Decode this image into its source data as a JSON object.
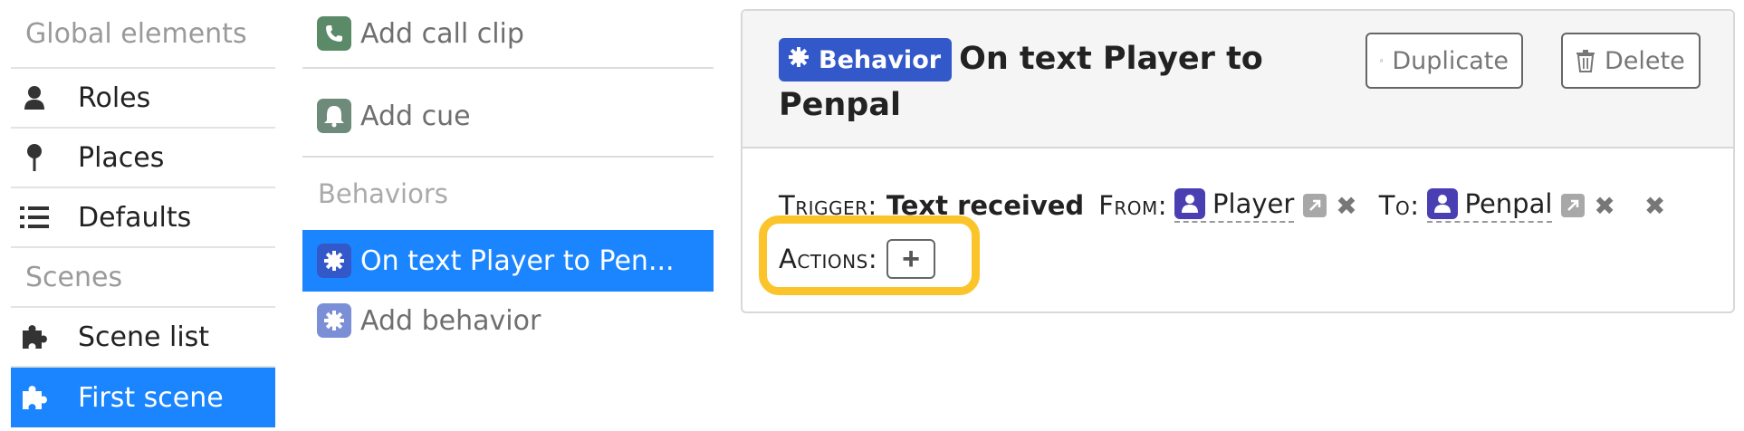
{
  "sidebar": {
    "global_heading": "Global elements",
    "items": [
      {
        "label": "Roles",
        "icon": "person-icon"
      },
      {
        "label": "Places",
        "icon": "map-pin-icon"
      },
      {
        "label": "Defaults",
        "icon": "list-icon"
      }
    ],
    "scenes_heading": "Scenes",
    "scene_items": [
      {
        "label": "Scene list",
        "icon": "puzzle-icon",
        "active": false
      },
      {
        "label": "First scene",
        "icon": "puzzle-icon",
        "active": true
      }
    ]
  },
  "middle": {
    "add_call_clip": "Add call clip",
    "add_cue": "Add cue",
    "behaviors_heading": "Behaviors",
    "behavior_item": "On text Player to Pen...",
    "add_behavior": "Add behavior"
  },
  "panel": {
    "badge": "Behavior",
    "title": "On text Player to Penpal",
    "duplicate_label": "Duplicate",
    "delete_label": "Delete",
    "trigger_label": "Trigger:",
    "trigger_value": "Text received",
    "from_label": "From:",
    "from_role": "Player",
    "to_label": "To:",
    "to_role": "Penpal",
    "actions_label": "Actions:",
    "add_action_label": "+"
  },
  "colors": {
    "accent": "#1a85ff",
    "badge": "#3358c9",
    "role_avatar": "#4a3fb2",
    "clip_icon": "#5b8a68",
    "highlight": "#fbc42a"
  }
}
